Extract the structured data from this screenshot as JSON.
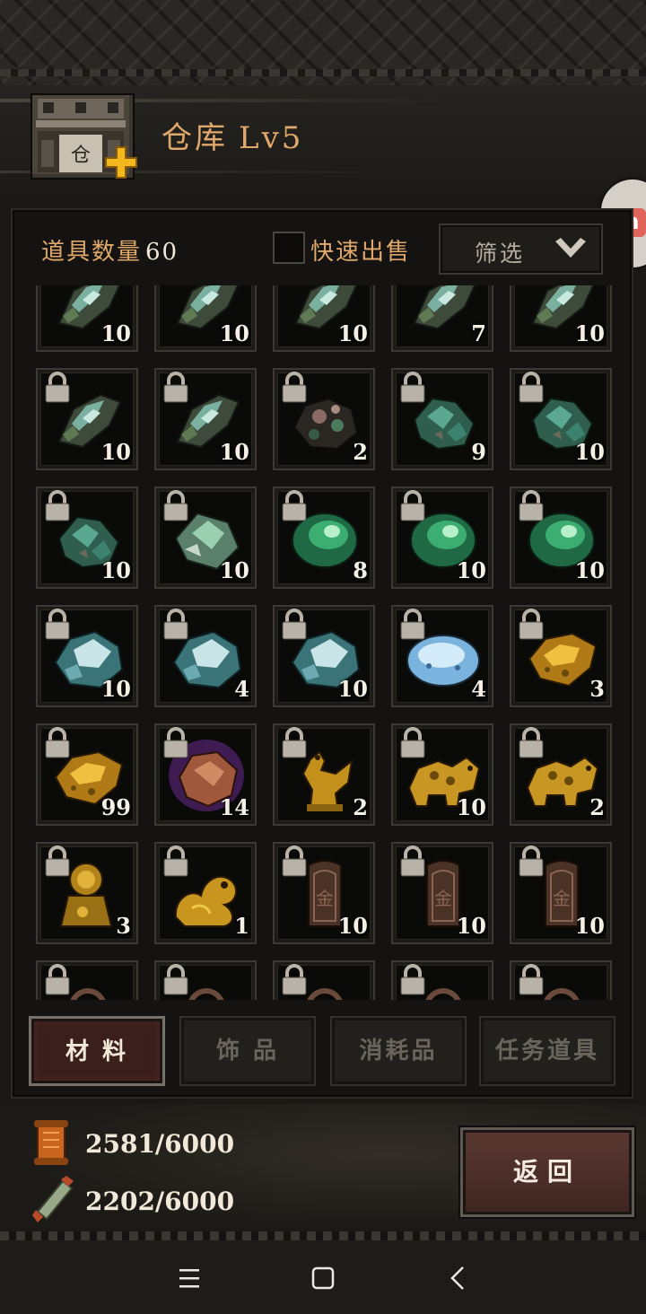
{
  "header": {
    "title": "仓库",
    "level": "Lv5"
  },
  "toolbar": {
    "item_count_label": "道具数量",
    "item_count_value": "60",
    "quick_sell_label": "快速出售",
    "filter_label": "筛选"
  },
  "items": [
    {
      "type": "crystal-shard",
      "qty": "10",
      "locked": false,
      "clipped": "top"
    },
    {
      "type": "crystal-shard",
      "qty": "10",
      "locked": false,
      "clipped": "top"
    },
    {
      "type": "crystal-shard",
      "qty": "10",
      "locked": false,
      "clipped": "top"
    },
    {
      "type": "crystal-shard",
      "qty": "7",
      "locked": false,
      "clipped": "top"
    },
    {
      "type": "crystal-shard",
      "qty": "10",
      "locked": false,
      "clipped": "top"
    },
    {
      "type": "crystal-shard",
      "qty": "10",
      "locked": true
    },
    {
      "type": "crystal-shard",
      "qty": "10",
      "locked": true
    },
    {
      "type": "dark-ore",
      "qty": "2",
      "locked": true
    },
    {
      "type": "green-ore",
      "qty": "9",
      "locked": true
    },
    {
      "type": "green-ore",
      "qty": "10",
      "locked": true
    },
    {
      "type": "green-ore",
      "qty": "10",
      "locked": true
    },
    {
      "type": "jade-rough",
      "qty": "10",
      "locked": true
    },
    {
      "type": "jade-gem",
      "qty": "8",
      "locked": true
    },
    {
      "type": "jade-gem",
      "qty": "10",
      "locked": true
    },
    {
      "type": "jade-gem",
      "qty": "10",
      "locked": true
    },
    {
      "type": "ice-crystal",
      "qty": "10",
      "locked": true
    },
    {
      "type": "ice-crystal",
      "qty": "4",
      "locked": true
    },
    {
      "type": "ice-crystal",
      "qty": "10",
      "locked": true
    },
    {
      "type": "blue-stone",
      "qty": "4",
      "locked": true
    },
    {
      "type": "gold-nugget",
      "qty": "3",
      "locked": true
    },
    {
      "type": "gold-nugget",
      "qty": "99",
      "locked": true
    },
    {
      "type": "copper-nugget",
      "qty": "14",
      "locked": true
    },
    {
      "type": "gold-rooster",
      "qty": "2",
      "locked": true
    },
    {
      "type": "gold-beast",
      "qty": "10",
      "locked": true
    },
    {
      "type": "gold-beast",
      "qty": "2",
      "locked": true
    },
    {
      "type": "gold-lion",
      "qty": "3",
      "locked": true
    },
    {
      "type": "gold-dragon",
      "qty": "1",
      "locked": true
    },
    {
      "type": "bronze-token",
      "qty": "10",
      "locked": true
    },
    {
      "type": "bronze-token",
      "qty": "10",
      "locked": true
    },
    {
      "type": "bronze-token",
      "qty": "10",
      "locked": true
    },
    {
      "type": "bronze-ring",
      "qty": "",
      "locked": true,
      "clipped": "bottom"
    },
    {
      "type": "bronze-ring",
      "qty": "",
      "locked": true,
      "clipped": "bottom"
    },
    {
      "type": "bronze-ring",
      "qty": "",
      "locked": true,
      "clipped": "bottom"
    },
    {
      "type": "bronze-ring",
      "qty": "",
      "locked": true,
      "clipped": "bottom"
    },
    {
      "type": "bronze-ring",
      "qty": "",
      "locked": true,
      "clipped": "bottom"
    }
  ],
  "tabs": [
    {
      "label": "材 料",
      "active": true
    },
    {
      "label": "饰 品",
      "active": false
    },
    {
      "label": "消耗品",
      "active": false
    },
    {
      "label": "任务道具",
      "active": false
    }
  ],
  "resources": [
    {
      "icon": "scroll-orange-icon",
      "value": "2581/6000"
    },
    {
      "icon": "scroll-green-icon",
      "value": "2202/6000"
    }
  ],
  "back_button": {
    "label": "返回"
  },
  "colors": {
    "accent_orange": "#e0a86a",
    "active_tab": "#3a1f1c",
    "background": "#1b1916"
  }
}
